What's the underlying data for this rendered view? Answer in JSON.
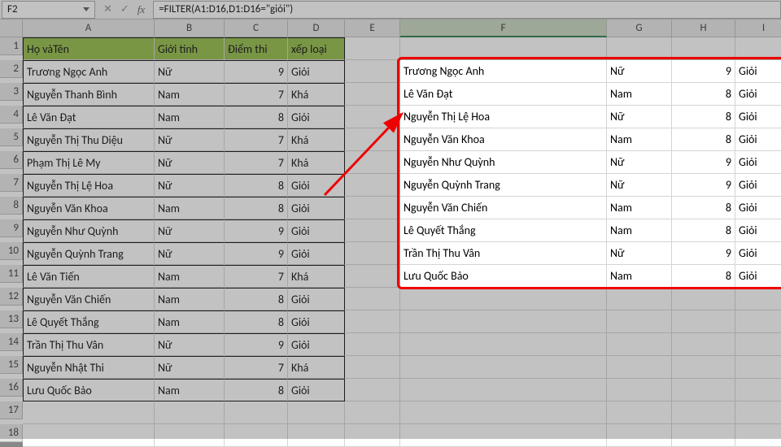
{
  "nameBox": "F2",
  "formula": "=FILTER(A1:D16,D1:D16=\"giỏi\")",
  "fxIcons": {
    "cancel": "✕",
    "confirm": "✓",
    "fx": "fx"
  },
  "columns": [
    "A",
    "B",
    "C",
    "D",
    "E",
    "F",
    "G",
    "H",
    "I"
  ],
  "rowNumbers": [
    1,
    2,
    3,
    4,
    5,
    6,
    7,
    8,
    9,
    10,
    11,
    12,
    13,
    14,
    15,
    16,
    17,
    18
  ],
  "headers": {
    "A": "Họ vàTên",
    "B": "Giới tính",
    "C": "Điểm thi",
    "D": "xếp loại"
  },
  "source": [
    {
      "name": "Trương Ngọc Anh",
      "gender": "Nữ",
      "score": 9,
      "rank": "Giỏi"
    },
    {
      "name": "Nguyễn Thanh Bình",
      "gender": "Nam",
      "score": 7,
      "rank": "Khá"
    },
    {
      "name": "Lê Văn Đạt",
      "gender": "Nam",
      "score": 8,
      "rank": "Giỏi"
    },
    {
      "name": "Nguyễn Thị Thu Diệu",
      "gender": "Nữ",
      "score": 7,
      "rank": "Khá"
    },
    {
      "name": "Phạm Thị Lê My",
      "gender": "Nữ",
      "score": 7,
      "rank": "Khá"
    },
    {
      "name": "Nguyễn Thị Lệ Hoa",
      "gender": "Nữ",
      "score": 8,
      "rank": "Giỏi"
    },
    {
      "name": "Nguyễn Văn Khoa",
      "gender": "Nam",
      "score": 8,
      "rank": "Giỏi"
    },
    {
      "name": "Nguyễn Như Quỳnh",
      "gender": "Nữ",
      "score": 9,
      "rank": "Giỏi"
    },
    {
      "name": "Nguyễn Quỳnh Trang",
      "gender": "Nữ",
      "score": 9,
      "rank": "Giỏi"
    },
    {
      "name": "Lê Văn Tiến",
      "gender": "Nam",
      "score": 7,
      "rank": "Khá"
    },
    {
      "name": "Nguyễn Văn Chiến",
      "gender": "Nam",
      "score": 8,
      "rank": "Giỏi"
    },
    {
      "name": "Lê Quyết Thắng",
      "gender": "Nam",
      "score": 8,
      "rank": "Giỏi"
    },
    {
      "name": "Trần Thị Thu Vân",
      "gender": "Nữ",
      "score": 9,
      "rank": "Giỏi"
    },
    {
      "name": "Nguyễn Nhật Thi",
      "gender": "Nữ",
      "score": 7,
      "rank": "Khá"
    },
    {
      "name": "Lưu Quốc Bảo",
      "gender": "Nam",
      "score": 8,
      "rank": "Giỏi"
    }
  ],
  "filtered": [
    {
      "name": "Trương Ngọc Anh",
      "gender": "Nữ",
      "score": 9,
      "rank": "Giỏi"
    },
    {
      "name": "Lê Văn Đạt",
      "gender": "Nam",
      "score": 8,
      "rank": "Giỏi"
    },
    {
      "name": "Nguyễn Thị Lệ Hoa",
      "gender": "Nữ",
      "score": 8,
      "rank": "Giỏi"
    },
    {
      "name": "Nguyễn Văn Khoa",
      "gender": "Nam",
      "score": 8,
      "rank": "Giỏi"
    },
    {
      "name": "Nguyễn Như Quỳnh",
      "gender": "Nữ",
      "score": 9,
      "rank": "Giỏi"
    },
    {
      "name": "Nguyễn Quỳnh Trang",
      "gender": "Nữ",
      "score": 9,
      "rank": "Giỏi"
    },
    {
      "name": "Nguyễn Văn Chiến",
      "gender": "Nam",
      "score": 8,
      "rank": "Giỏi"
    },
    {
      "name": "Lê Quyết Thắng",
      "gender": "Nam",
      "score": 8,
      "rank": "Giỏi"
    },
    {
      "name": "Trần Thị Thu Vân",
      "gender": "Nữ",
      "score": 9,
      "rank": "Giỏi"
    },
    {
      "name": "Lưu Quốc Bảo",
      "gender": "Nam",
      "score": 8,
      "rank": "Giỏi"
    }
  ]
}
